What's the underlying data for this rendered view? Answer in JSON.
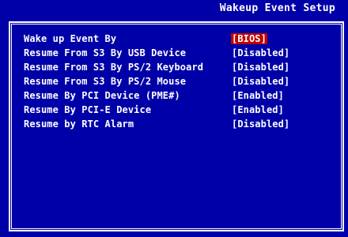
{
  "header": {
    "title": "Wakeup Event Setup"
  },
  "colors": {
    "background": "#0000a8",
    "text": "#ffffff",
    "highlight": "#c00000"
  },
  "settings": [
    {
      "label": "Wake up Event By",
      "value": "[BIOS]",
      "selected": true
    },
    {
      "label": "Resume From S3 By USB Device",
      "value": "[Disabled]",
      "selected": false
    },
    {
      "label": "Resume From S3 By PS/2 Keyboard",
      "value": "[Disabled]",
      "selected": false
    },
    {
      "label": "Resume From S3 By PS/2 Mouse",
      "value": "[Disabled]",
      "selected": false
    },
    {
      "label": "Resume By PCI Device (PME#)",
      "value": "[Enabled]",
      "selected": false
    },
    {
      "label": "Resume By PCI-E Device",
      "value": "[Enabled]",
      "selected": false
    },
    {
      "label": "Resume by RTC Alarm",
      "value": "[Disabled]",
      "selected": false
    }
  ]
}
